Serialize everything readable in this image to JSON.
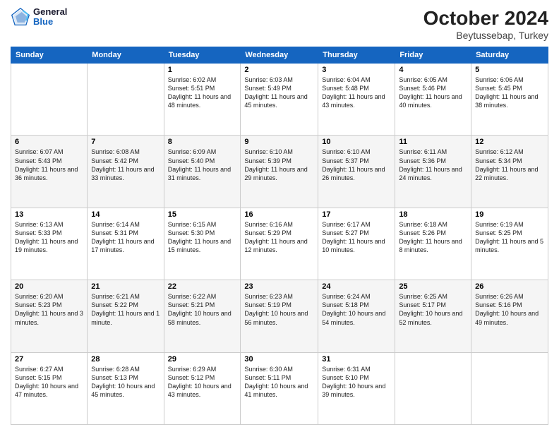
{
  "logo": {
    "line1": "General",
    "line2": "Blue"
  },
  "title": "October 2024",
  "subtitle": "Beytussebap, Turkey",
  "days_of_week": [
    "Sunday",
    "Monday",
    "Tuesday",
    "Wednesday",
    "Thursday",
    "Friday",
    "Saturday"
  ],
  "weeks": [
    [
      {
        "day": "",
        "info": ""
      },
      {
        "day": "",
        "info": ""
      },
      {
        "day": "1",
        "info": "Sunrise: 6:02 AM\nSunset: 5:51 PM\nDaylight: 11 hours and 48 minutes."
      },
      {
        "day": "2",
        "info": "Sunrise: 6:03 AM\nSunset: 5:49 PM\nDaylight: 11 hours and 45 minutes."
      },
      {
        "day": "3",
        "info": "Sunrise: 6:04 AM\nSunset: 5:48 PM\nDaylight: 11 hours and 43 minutes."
      },
      {
        "day": "4",
        "info": "Sunrise: 6:05 AM\nSunset: 5:46 PM\nDaylight: 11 hours and 40 minutes."
      },
      {
        "day": "5",
        "info": "Sunrise: 6:06 AM\nSunset: 5:45 PM\nDaylight: 11 hours and 38 minutes."
      }
    ],
    [
      {
        "day": "6",
        "info": "Sunrise: 6:07 AM\nSunset: 5:43 PM\nDaylight: 11 hours and 36 minutes."
      },
      {
        "day": "7",
        "info": "Sunrise: 6:08 AM\nSunset: 5:42 PM\nDaylight: 11 hours and 33 minutes."
      },
      {
        "day": "8",
        "info": "Sunrise: 6:09 AM\nSunset: 5:40 PM\nDaylight: 11 hours and 31 minutes."
      },
      {
        "day": "9",
        "info": "Sunrise: 6:10 AM\nSunset: 5:39 PM\nDaylight: 11 hours and 29 minutes."
      },
      {
        "day": "10",
        "info": "Sunrise: 6:10 AM\nSunset: 5:37 PM\nDaylight: 11 hours and 26 minutes."
      },
      {
        "day": "11",
        "info": "Sunrise: 6:11 AM\nSunset: 5:36 PM\nDaylight: 11 hours and 24 minutes."
      },
      {
        "day": "12",
        "info": "Sunrise: 6:12 AM\nSunset: 5:34 PM\nDaylight: 11 hours and 22 minutes."
      }
    ],
    [
      {
        "day": "13",
        "info": "Sunrise: 6:13 AM\nSunset: 5:33 PM\nDaylight: 11 hours and 19 minutes."
      },
      {
        "day": "14",
        "info": "Sunrise: 6:14 AM\nSunset: 5:31 PM\nDaylight: 11 hours and 17 minutes."
      },
      {
        "day": "15",
        "info": "Sunrise: 6:15 AM\nSunset: 5:30 PM\nDaylight: 11 hours and 15 minutes."
      },
      {
        "day": "16",
        "info": "Sunrise: 6:16 AM\nSunset: 5:29 PM\nDaylight: 11 hours and 12 minutes."
      },
      {
        "day": "17",
        "info": "Sunrise: 6:17 AM\nSunset: 5:27 PM\nDaylight: 11 hours and 10 minutes."
      },
      {
        "day": "18",
        "info": "Sunrise: 6:18 AM\nSunset: 5:26 PM\nDaylight: 11 hours and 8 minutes."
      },
      {
        "day": "19",
        "info": "Sunrise: 6:19 AM\nSunset: 5:25 PM\nDaylight: 11 hours and 5 minutes."
      }
    ],
    [
      {
        "day": "20",
        "info": "Sunrise: 6:20 AM\nSunset: 5:23 PM\nDaylight: 11 hours and 3 minutes."
      },
      {
        "day": "21",
        "info": "Sunrise: 6:21 AM\nSunset: 5:22 PM\nDaylight: 11 hours and 1 minute."
      },
      {
        "day": "22",
        "info": "Sunrise: 6:22 AM\nSunset: 5:21 PM\nDaylight: 10 hours and 58 minutes."
      },
      {
        "day": "23",
        "info": "Sunrise: 6:23 AM\nSunset: 5:19 PM\nDaylight: 10 hours and 56 minutes."
      },
      {
        "day": "24",
        "info": "Sunrise: 6:24 AM\nSunset: 5:18 PM\nDaylight: 10 hours and 54 minutes."
      },
      {
        "day": "25",
        "info": "Sunrise: 6:25 AM\nSunset: 5:17 PM\nDaylight: 10 hours and 52 minutes."
      },
      {
        "day": "26",
        "info": "Sunrise: 6:26 AM\nSunset: 5:16 PM\nDaylight: 10 hours and 49 minutes."
      }
    ],
    [
      {
        "day": "27",
        "info": "Sunrise: 6:27 AM\nSunset: 5:15 PM\nDaylight: 10 hours and 47 minutes."
      },
      {
        "day": "28",
        "info": "Sunrise: 6:28 AM\nSunset: 5:13 PM\nDaylight: 10 hours and 45 minutes."
      },
      {
        "day": "29",
        "info": "Sunrise: 6:29 AM\nSunset: 5:12 PM\nDaylight: 10 hours and 43 minutes."
      },
      {
        "day": "30",
        "info": "Sunrise: 6:30 AM\nSunset: 5:11 PM\nDaylight: 10 hours and 41 minutes."
      },
      {
        "day": "31",
        "info": "Sunrise: 6:31 AM\nSunset: 5:10 PM\nDaylight: 10 hours and 39 minutes."
      },
      {
        "day": "",
        "info": ""
      },
      {
        "day": "",
        "info": ""
      }
    ]
  ]
}
